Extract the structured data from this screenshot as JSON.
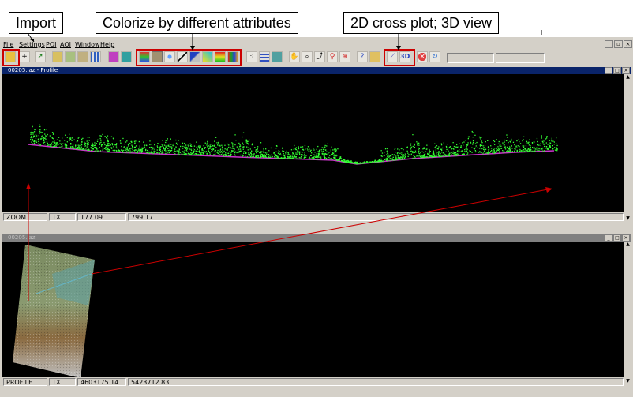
{
  "callouts": {
    "import": "Import",
    "colorize": "Colorize by different attributes",
    "cross": "2D cross plot; 3D view"
  },
  "menu": [
    "File",
    "Settings",
    "POI",
    "AOI",
    "Window",
    "Help"
  ],
  "toolbar": {
    "three_d_label": "3D"
  },
  "profile_window": {
    "title": "00205.laz - Profile",
    "status": {
      "mode": "ZOOM",
      "zoom": "1X",
      "x": "177.09",
      "y": "799.17"
    }
  },
  "map_window": {
    "title": "00205.laz",
    "status": {
      "mode": "PROFILE",
      "zoom": "1X",
      "x": "4603175.14",
      "y": "5423712.83"
    }
  },
  "colors": {
    "highlight": "#cc0000",
    "points": "#33ff33",
    "ground": "#cc33cc"
  },
  "icons": [
    "open-file-icon",
    "add-file-icon",
    "arrow-icon",
    "pencil-icon",
    "palette-icon",
    "grid-icon",
    "pattern-icon",
    "image-icon",
    "layer-icon"
  ]
}
